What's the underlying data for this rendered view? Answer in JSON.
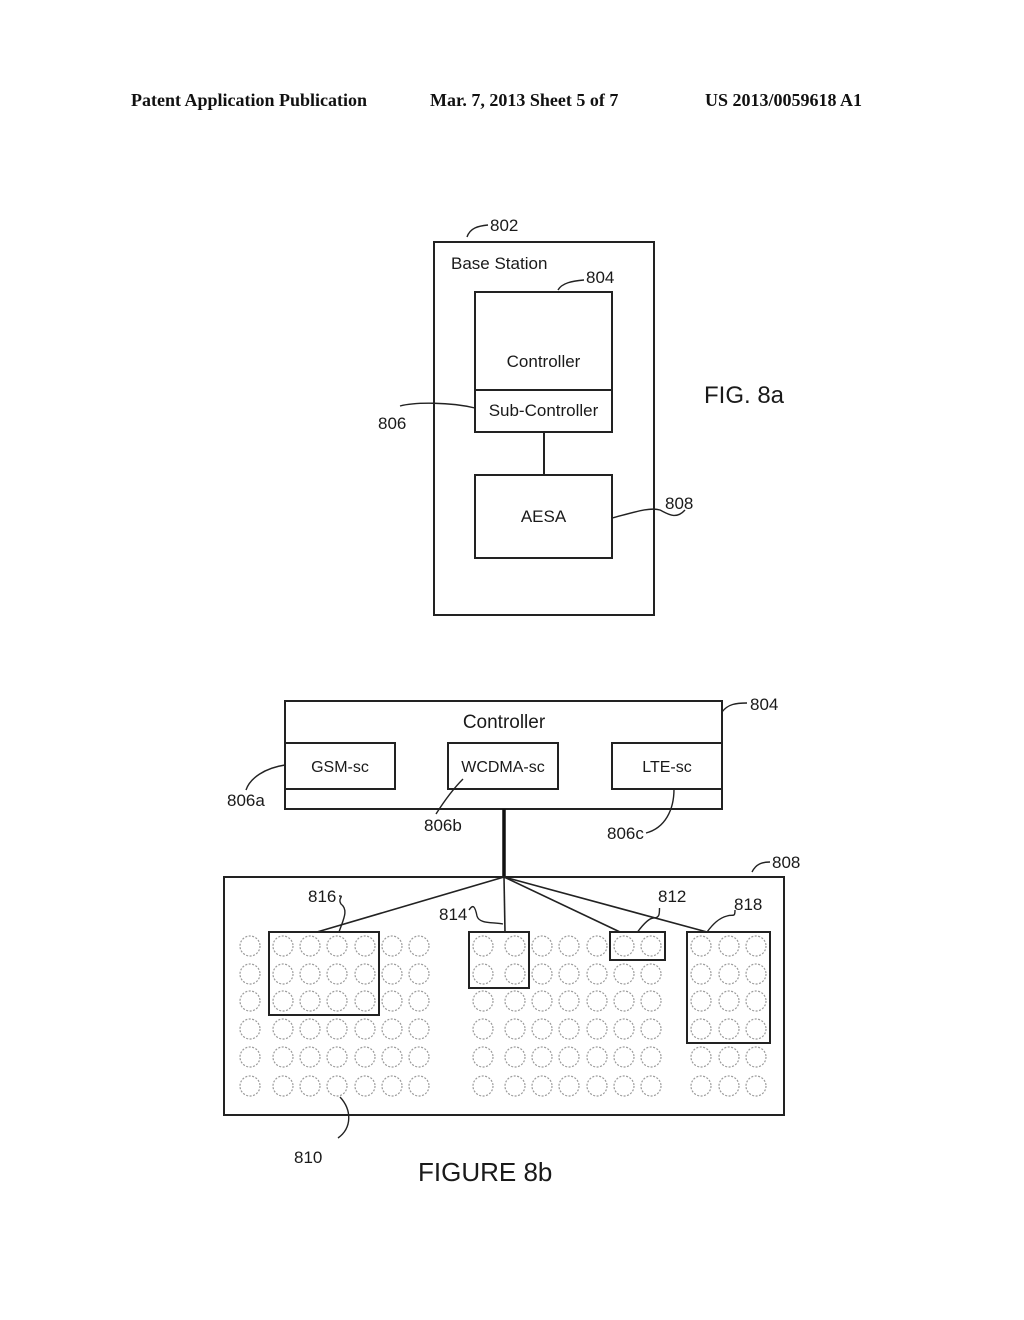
{
  "header": {
    "publication": "Patent Application Publication",
    "date_sheet": "Mar. 7, 2013   Sheet 5 of 7",
    "number": "US 2013/0059618 A1"
  },
  "fig8a": {
    "caption": "FIG. 8a",
    "base_station": {
      "label": "Base Station",
      "ref": "802"
    },
    "controller": {
      "label": "Controller",
      "ref": "804"
    },
    "sub_controller": {
      "label": "Sub-Controller",
      "ref": "806"
    },
    "aesa": {
      "label": "AESA",
      "ref": "808"
    }
  },
  "fig8b": {
    "caption": "FIGURE 8b",
    "controller": {
      "label": "Controller",
      "ref": "804"
    },
    "sub_controllers": [
      {
        "label": "GSM-sc",
        "ref": "806a"
      },
      {
        "label": "WCDMA-sc",
        "ref": "806b"
      },
      {
        "label": "LTE-sc",
        "ref": "806c"
      }
    ],
    "array": {
      "ref": "808",
      "element_ref": "810",
      "rows": 6,
      "column_groups": [
        7,
        7,
        3
      ]
    },
    "subarrays": [
      {
        "ref": "816",
        "group": 0,
        "cols": [
          1,
          4
        ],
        "rows": [
          0,
          2
        ]
      },
      {
        "ref": "814",
        "group": 1,
        "cols": [
          0,
          1
        ],
        "rows": [
          0,
          1
        ]
      },
      {
        "ref": "812",
        "group": 1,
        "cols": [
          5,
          6
        ],
        "rows": [
          0,
          0
        ]
      },
      {
        "ref": "818",
        "group": 2,
        "cols": [
          0,
          2
        ],
        "rows": [
          0,
          3
        ]
      }
    ]
  }
}
